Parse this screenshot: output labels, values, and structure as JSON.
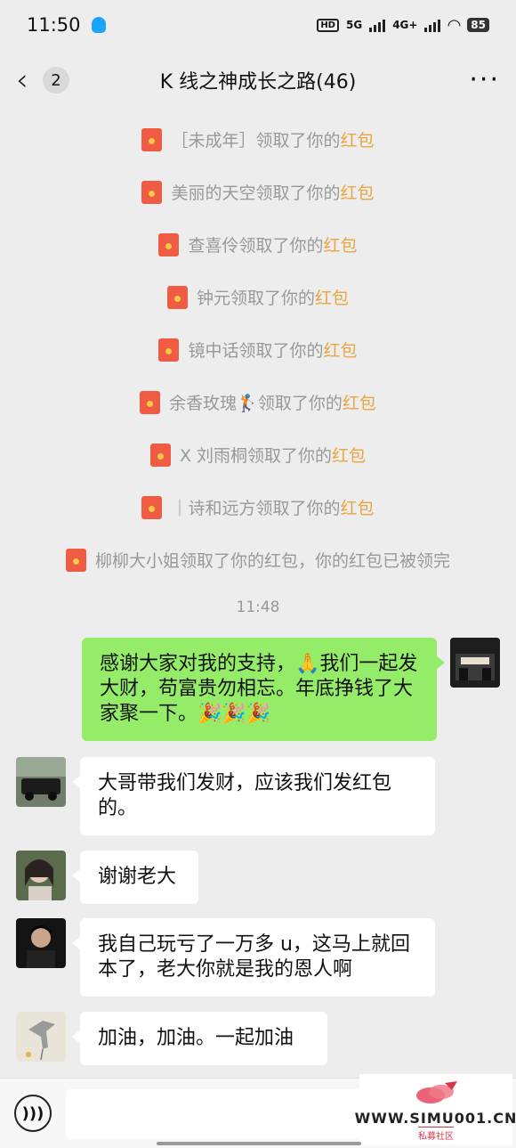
{
  "status_bar": {
    "time": "11:50",
    "net1": "5G",
    "net2": "4G+",
    "battery": "85"
  },
  "nav": {
    "unread_count": "2",
    "title": "K 线之神成长之路(46)"
  },
  "notices": [
    {
      "prefix": "［未成年］领取了你的",
      "link": "红包",
      "suffix": ""
    },
    {
      "prefix": "美丽的天空领取了你的",
      "link": "红包",
      "suffix": ""
    },
    {
      "prefix": "查喜伶领取了你的",
      "link": "红包",
      "suffix": ""
    },
    {
      "prefix": "钟元领取了你的",
      "link": "红包",
      "suffix": ""
    },
    {
      "prefix": "镜中话领取了你的",
      "link": "红包",
      "suffix": ""
    },
    {
      "prefix": "余香玫瑰🏌领取了你的",
      "link": "红包",
      "suffix": ""
    },
    {
      "prefix": "X 刘雨桐领取了你的",
      "link": "红包",
      "suffix": ""
    },
    {
      "prefix": "｜诗和远方领取了你的",
      "link": "红包",
      "suffix": ""
    },
    {
      "prefix": "柳柳大小姐领取了你的红包，你的红包已被领完",
      "link": "",
      "suffix": ""
    }
  ],
  "timestamp": "11:48",
  "messages": [
    {
      "side": "right",
      "text": "感谢大家对我的支持，🙏我们一起发大财，苟富贵勿相忘。年底挣钱了大家聚一下。🎉🎉🎉"
    },
    {
      "side": "left",
      "text": "大哥带我们发财，应该我们发红包的。"
    },
    {
      "side": "left",
      "text": "谢谢老大"
    },
    {
      "side": "left",
      "text": "我自己玩亏了一万多 u，这马上就回本了，老大你就是我的恩人啊"
    },
    {
      "side": "left",
      "text": "加油，加油。一起加油"
    }
  ],
  "watermark": {
    "url": "WWW.SIMU001.CN",
    "sub": "私募社区"
  },
  "colors": {
    "background": "#ededed",
    "bubble_self": "#95ec69",
    "bubble_other": "#ffffff",
    "link": "#e9a540",
    "red_packet": "#f05b44"
  },
  "icons": [
    "back-chevron-icon",
    "more-dots-icon",
    "red-packet-icon",
    "voice-icon"
  ]
}
